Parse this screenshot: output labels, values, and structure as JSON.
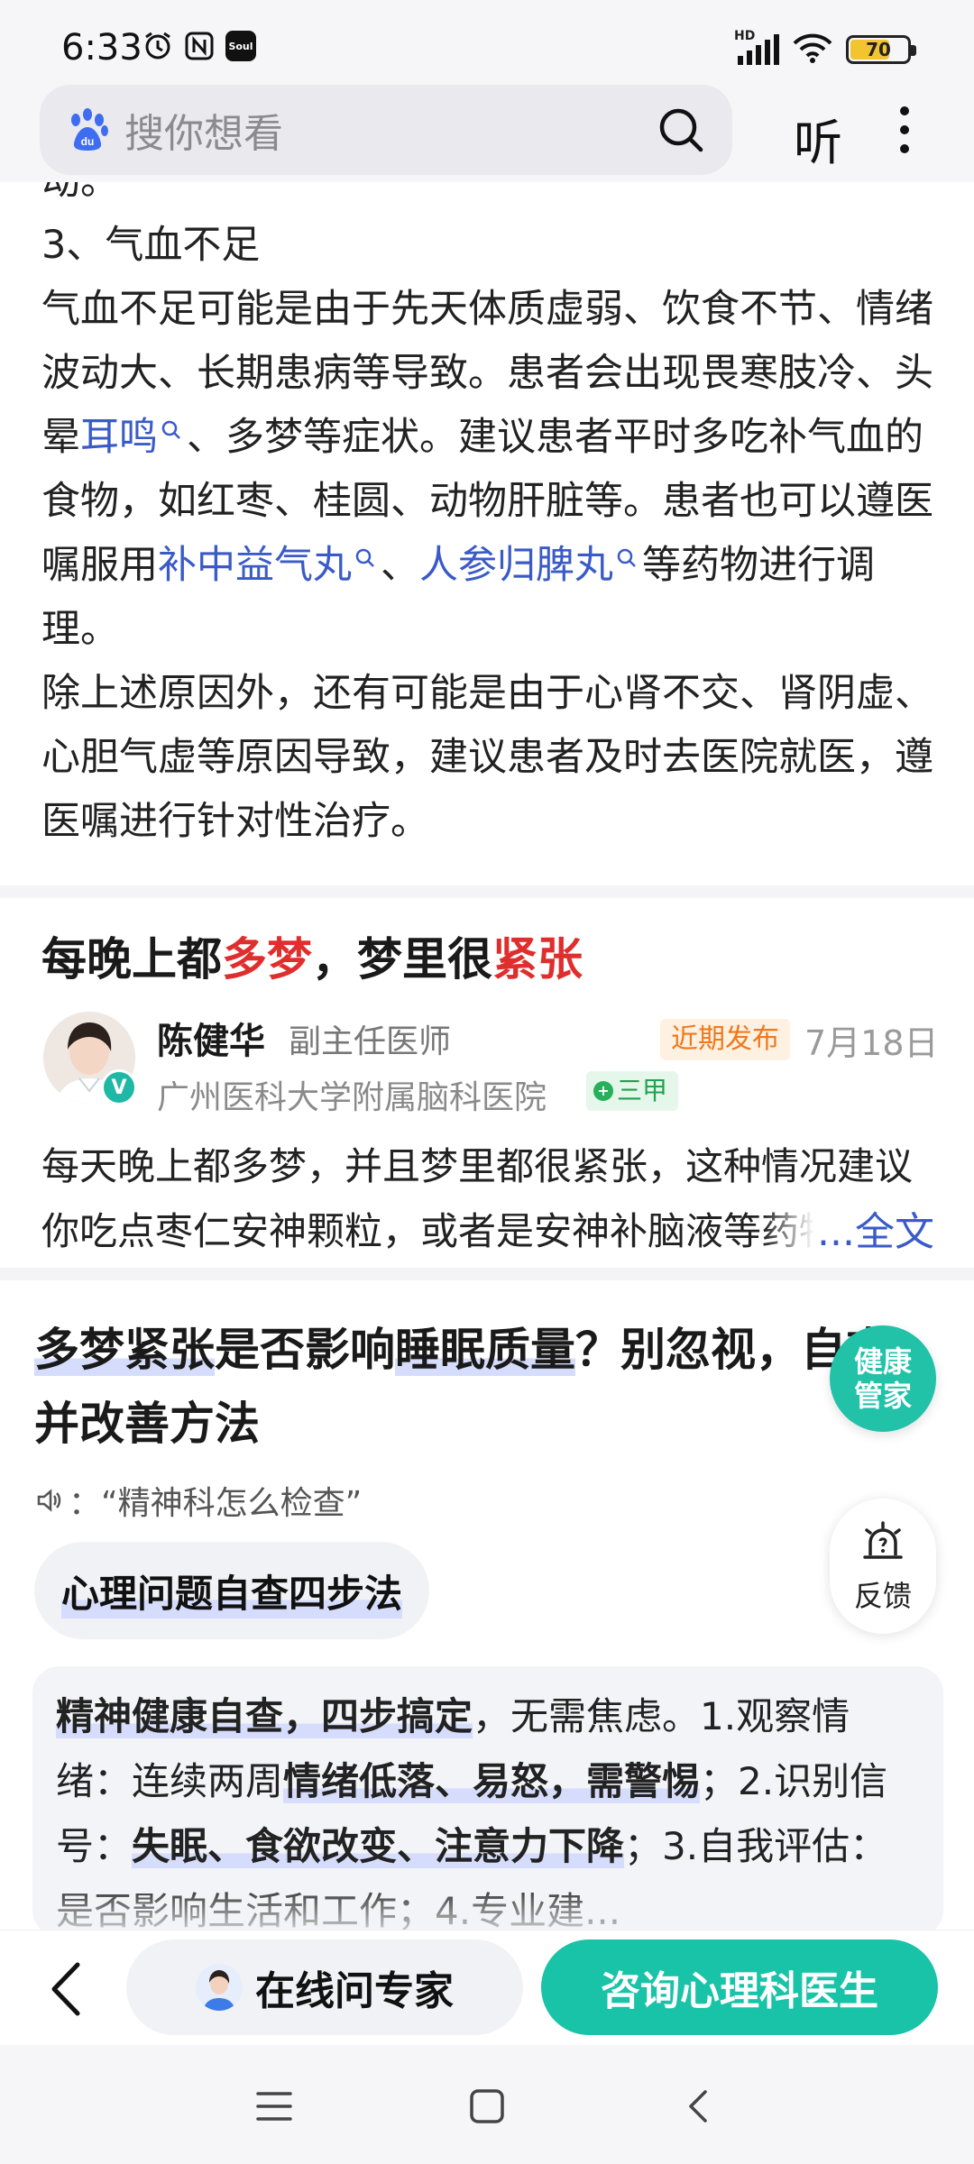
{
  "status_bar": {
    "time": "6:33",
    "battery": "70",
    "battery_level": 0.7,
    "network_label": "HD",
    "soul_label": "Soul"
  },
  "header": {
    "search_placeholder": "搜你想看",
    "listen_label": "听"
  },
  "article": {
    "cut_line": "动。",
    "section_heading": "3、气血不足",
    "para1_a": "气血不足可能是由于先天体质虚弱、饮食不节、情绪波动大、长期患病等导致。患者会出现畏寒肢冷、头晕",
    "link_erming": "耳鸣",
    "para1_b": "、多梦等症状。建议患者平时多吃补气血的食物，如红枣、桂圆、动物肝脏等。患者也可以遵医嘱服用",
    "link_buzhong": "补中益气丸",
    "para1_sep": "、",
    "link_renshen": "人参归脾丸",
    "para1_c": "等药物进行调理。",
    "para2": "除上述原因外，还有可能是由于心肾不交、肾阴虚、心胆气虚等原因导致，建议患者及时去医院就医，遵医嘱进行针对性治疗。"
  },
  "card2": {
    "title_part1": "每晚上都",
    "title_red1": "多梦",
    "title_part2": "，梦里很",
    "title_red2": "紧张",
    "doctor_name": "陈健华",
    "doctor_title": "副主任医师",
    "recent_badge": "近期发布",
    "date": "7月18日",
    "hospital": "广州医科大学附属脑科医院",
    "grade": "三甲",
    "excerpt": "每天晚上都多梦，并且梦里都很紧张，这种情况建议你吃点枣仁安神颗粒，或者是安神补脑液等药物进行调理。",
    "full_text_link": "...全文"
  },
  "card3": {
    "title_hl1": "多梦紧张",
    "title_t1": "是否影响",
    "title_hl2": "睡眠质量",
    "title_t2": "？别忽视，自查并改善方法",
    "voice_query": "：“精神科怎么检查”",
    "chip_label": "心理问题自查四步法",
    "ans_b1": "精神健康自查，四步搞定",
    "ans_t1": "，无需焦虑。1.观察情绪：连续两周",
    "ans_b2": "情绪低落、易怒，需警惕",
    "ans_t2": "；2.识别信号：",
    "ans_b3": "失眠、食欲改变、注意力下降",
    "ans_t3": "；3.自我评估：是否影响生活和工作；4.专业建..."
  },
  "floating": {
    "health_label": "健康管家",
    "feedback_label": "反馈"
  },
  "bottom_bar": {
    "ask_expert": "在线问专家",
    "consult": "咨询心理科医生"
  },
  "colors": {
    "link": "#3a5bc7",
    "red": "#e02d2d",
    "teal": "#19c3a8",
    "highlight": "#d6dcfb"
  }
}
